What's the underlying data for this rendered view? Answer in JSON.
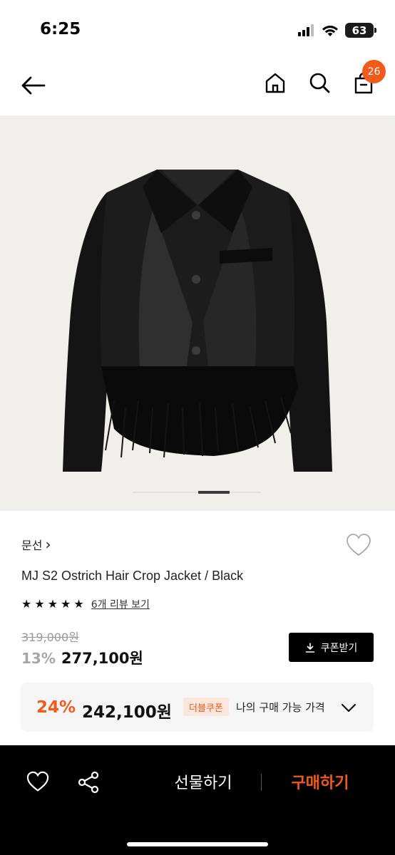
{
  "status_bar": {
    "time": "6:25",
    "battery": "63"
  },
  "nav": {
    "cart_count": "26"
  },
  "product": {
    "brand": "문선",
    "brand_chevron": "›",
    "name": "MJ S2 Ostrich Hair Crop Jacket / Black",
    "rating_stars": 5,
    "review_link": "6개 리뷰 보기",
    "original_price": "319,000원",
    "discount_rate": "13%",
    "sale_price": "277,100원",
    "coupon_button": "쿠폰받기"
  },
  "coupon_box": {
    "rate": "24%",
    "price": "242,100원",
    "badge": "더블쿠폰",
    "label": "나의 구매 가능 가격"
  },
  "bottom_bar": {
    "gift_label": "선물하기",
    "buy_label": "구매하기"
  },
  "colors": {
    "accent": "#f25a1c",
    "bottom_bar": "#000000"
  }
}
